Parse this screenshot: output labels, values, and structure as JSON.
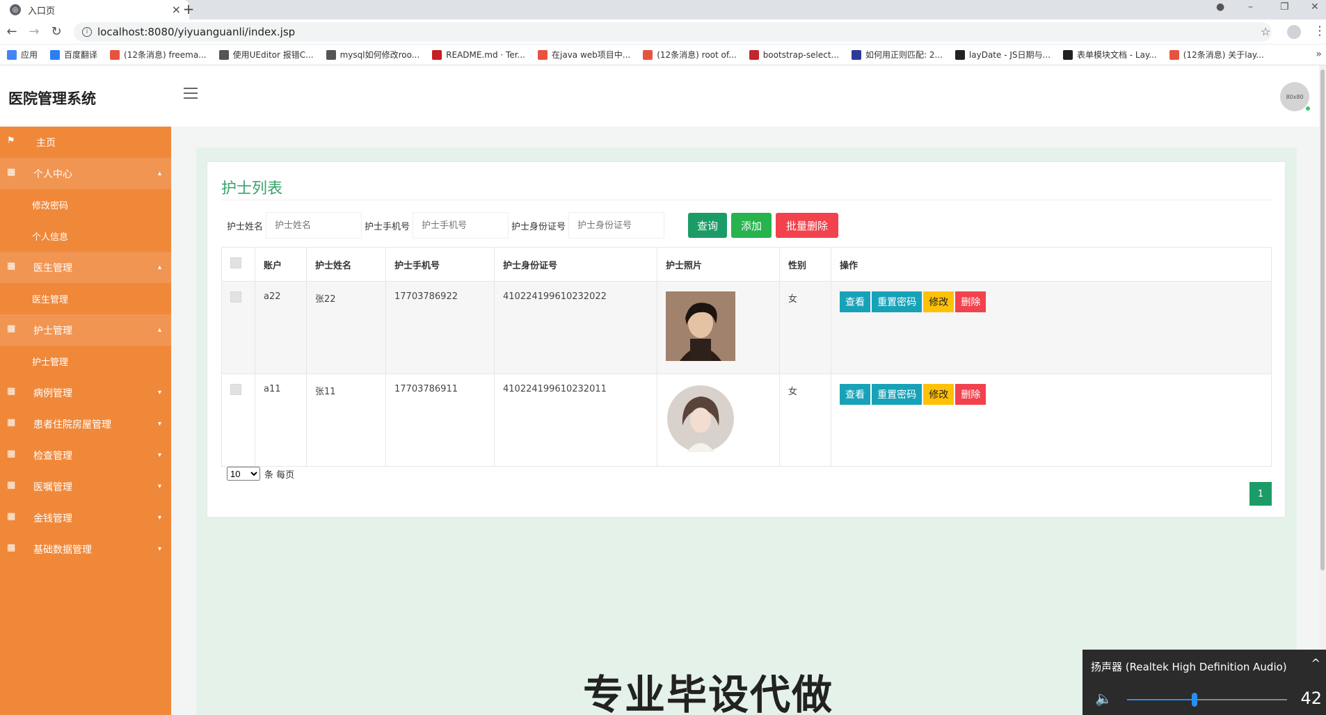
{
  "browser": {
    "tab_title": "入口页",
    "url": "localhost:8080/yiyuanguanli/index.jsp",
    "bookmarks": [
      {
        "label": "应用",
        "color": "#4285f4"
      },
      {
        "label": "百度翻译",
        "color": "#2b7ef5"
      },
      {
        "label": "(12条消息) freema...",
        "color": "#e8533f"
      },
      {
        "label": "使用UEditor 报错C...",
        "color": "#555555"
      },
      {
        "label": "mysql如何修改roo...",
        "color": "#555555"
      },
      {
        "label": "README.md · Ter...",
        "color": "#c71d23"
      },
      {
        "label": "在java web项目中...",
        "color": "#e8533f"
      },
      {
        "label": "(12条消息) root of...",
        "color": "#e8533f"
      },
      {
        "label": "bootstrap-select...",
        "color": "#c1272d"
      },
      {
        "label": "如何用正则匹配: 2...",
        "color": "#2b3a99"
      },
      {
        "label": "layDate - JS日期与...",
        "color": "#222222"
      },
      {
        "label": "表单模块文档 - Lay...",
        "color": "#222222"
      },
      {
        "label": "(12条消息) 关于lay...",
        "color": "#e8533f"
      }
    ]
  },
  "header": {
    "brand": "医院管理系统",
    "avatar_text": "80x80"
  },
  "sidebar": {
    "items": [
      {
        "label": "主页",
        "kind": "top",
        "icon": "flag-icon"
      },
      {
        "label": "个人中心",
        "kind": "group",
        "icon": "grid-icon",
        "caret": "up"
      },
      {
        "label": "修改密码",
        "kind": "sub"
      },
      {
        "label": "个人信息",
        "kind": "sub"
      },
      {
        "label": "医生管理",
        "kind": "group",
        "icon": "grid-icon",
        "caret": "up"
      },
      {
        "label": "医生管理",
        "kind": "sub"
      },
      {
        "label": "护士管理",
        "kind": "group",
        "icon": "grid-icon",
        "caret": "up"
      },
      {
        "label": "护士管理",
        "kind": "sub"
      },
      {
        "label": "病例管理",
        "kind": "plain",
        "icon": "grid-icon",
        "caret": "down"
      },
      {
        "label": "患者住院房屋管理",
        "kind": "plain",
        "icon": "grid-icon",
        "caret": "down"
      },
      {
        "label": "检查管理",
        "kind": "plain",
        "icon": "grid-icon",
        "caret": "down"
      },
      {
        "label": "医嘱管理",
        "kind": "plain",
        "icon": "grid-icon",
        "caret": "down"
      },
      {
        "label": "金钱管理",
        "kind": "plain",
        "icon": "grid-icon",
        "caret": "down"
      },
      {
        "label": "基础数据管理",
        "kind": "plain",
        "icon": "grid-icon",
        "caret": "down"
      }
    ]
  },
  "main": {
    "title": "护士列表",
    "search": {
      "name_label": "护士姓名",
      "name_placeholder": "护士姓名",
      "phone_label": "护士手机号",
      "phone_placeholder": "护士手机号",
      "id_label": "护士身份证号",
      "id_placeholder": "护士身份证号",
      "query_label": "查询",
      "add_label": "添加",
      "batch_delete_label": "批量删除"
    },
    "table": {
      "headers": [
        "账户",
        "护士姓名",
        "护士手机号",
        "护士身份证号",
        "护士照片",
        "性别",
        "操作"
      ],
      "rows": [
        {
          "account": "a22",
          "name": "张22",
          "phone": "17703786922",
          "id_no": "410224199610232022",
          "gender": "女"
        },
        {
          "account": "a11",
          "name": "张11",
          "phone": "17703786911",
          "id_no": "410224199610232011",
          "gender": "女"
        }
      ],
      "actions": {
        "view": "查看",
        "reset": "重置密码",
        "edit": "修改",
        "delete": "删除"
      }
    },
    "pager": {
      "page_size": "10",
      "page_size_suffix": "条 每页",
      "current_page": "1"
    }
  },
  "watermark": "专业毕设代做",
  "volume_popup": {
    "title": "扬声器 (Realtek High Definition Audio)",
    "value": "42",
    "level_percent": 42
  }
}
